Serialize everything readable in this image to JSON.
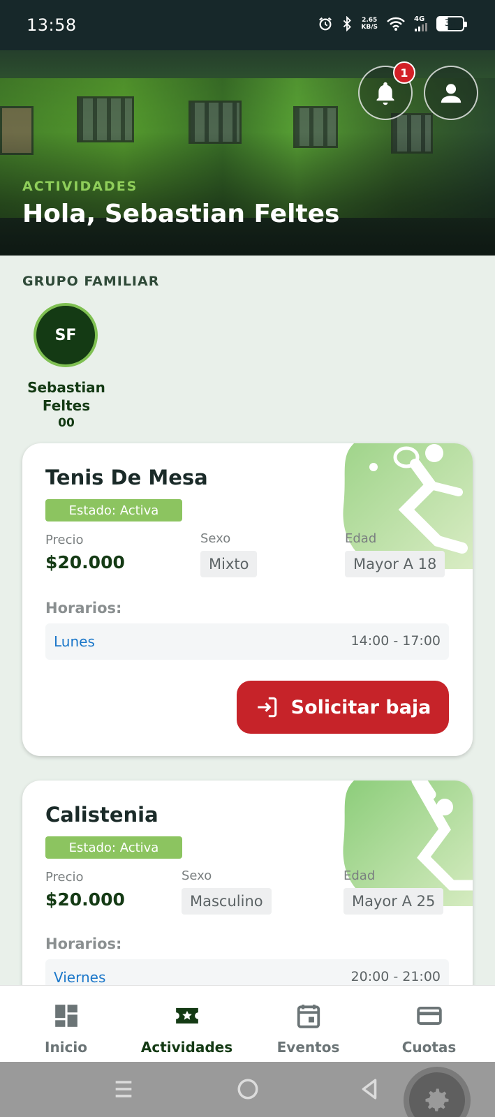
{
  "status_bar": {
    "time": "13:58",
    "net_speed_value": "2.65",
    "net_speed_unit": "KB/S",
    "network": "4G",
    "battery": "39"
  },
  "header": {
    "section": "ACTIVIDADES",
    "greeting": "Hola, Sebastian Feltes",
    "notification_count": "1",
    "bell_icon": "bell-icon",
    "profile_icon": "user-icon"
  },
  "family": {
    "title": "GRUPO FAMILIAR",
    "members": [
      {
        "initials": "SF",
        "first_name": "Sebastian",
        "last_name": "Feltes",
        "number": "00"
      }
    ]
  },
  "activities": [
    {
      "name": "Tenis De Mesa",
      "state": "Estado: Activa",
      "price_label": "Precio",
      "price": "$20.000",
      "sex_label": "Sexo",
      "sex": "Mixto",
      "age_label": "Edad",
      "age": "Mayor A 18",
      "schedule_title": "Horarios:",
      "schedule": [
        {
          "day": "Lunes",
          "hours": "14:00 - 17:00"
        }
      ],
      "action_label": "Solicitar baja",
      "icon": "table-tennis-icon"
    },
    {
      "name": "Calistenia",
      "state": "Estado: Activa",
      "price_label": "Precio",
      "price": "$20.000",
      "sex_label": "Sexo",
      "sex": "Masculino",
      "age_label": "Edad",
      "age": "Mayor A 25",
      "schedule_title": "Horarios:",
      "schedule": [
        {
          "day": "Viernes",
          "hours": "20:00 - 21:00"
        }
      ],
      "icon": "athlete-icon"
    }
  ],
  "bottom_nav": [
    {
      "label": "Inicio",
      "icon": "dashboard-icon",
      "active": false
    },
    {
      "label": "Actividades",
      "icon": "star-ticket-icon",
      "active": true
    },
    {
      "label": "Eventos",
      "icon": "calendar-icon",
      "active": false
    },
    {
      "label": "Cuotas",
      "icon": "credit-card-icon",
      "active": false
    }
  ],
  "colors": {
    "primary_dark": "#143a14",
    "accent_green": "#8cc460",
    "danger": "#c62329",
    "link_blue": "#1b77c9"
  }
}
